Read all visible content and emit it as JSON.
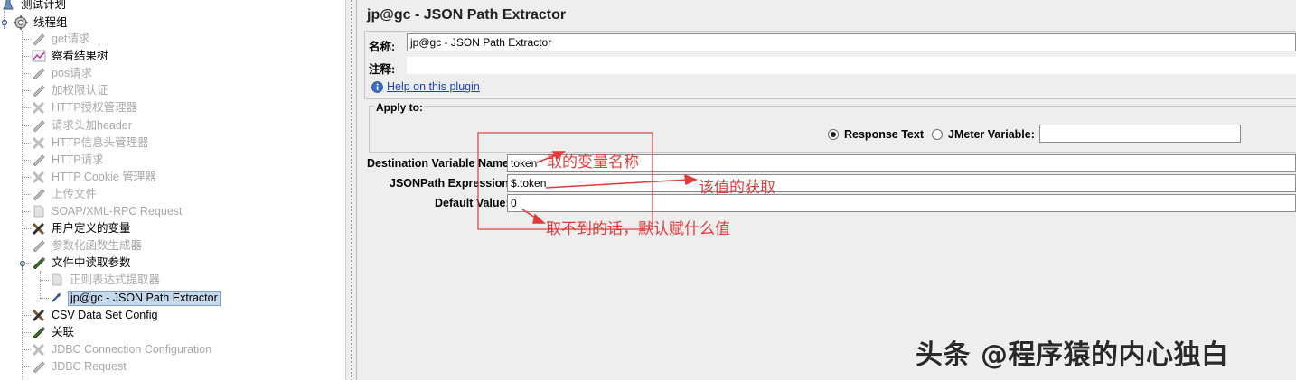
{
  "tree": {
    "root": "测试计划",
    "thread_group": "线程组",
    "items": [
      {
        "label": "get请求",
        "icon": "pencil-icon",
        "disabled": true
      },
      {
        "label": "察看结果树",
        "icon": "chart-icon",
        "disabled": false
      },
      {
        "label": "pos请求",
        "icon": "pencil-icon",
        "disabled": true
      },
      {
        "label": "加权限认证",
        "icon": "pencil-icon",
        "disabled": true
      },
      {
        "label": "HTTP授权管理器",
        "icon": "wrench-icon",
        "disabled": true
      },
      {
        "label": "请求头加header",
        "icon": "pencil-icon",
        "disabled": true
      },
      {
        "label": "HTTP信息头管理器",
        "icon": "wrench-icon",
        "disabled": true
      },
      {
        "label": "HTTP请求",
        "icon": "pencil-icon",
        "disabled": true
      },
      {
        "label": "HTTP Cookie 管理器",
        "icon": "wrench-icon",
        "disabled": true
      },
      {
        "label": "上传文件",
        "icon": "pencil-icon",
        "disabled": true
      },
      {
        "label": "SOAP/XML-RPC Request",
        "icon": "document-icon",
        "disabled": true
      },
      {
        "label": "用户定义的变量",
        "icon": "wrench-icon",
        "disabled": false
      },
      {
        "label": "参数化函数生成器",
        "icon": "pencil-icon",
        "disabled": true
      },
      {
        "label": "文件中读取参数",
        "icon": "pencil-icon",
        "disabled": false
      },
      {
        "label": "正则表达式提取器",
        "icon": "document-icon",
        "disabled": true
      },
      {
        "label": "jp@gc - JSON Path Extractor",
        "icon": "extractor-icon",
        "disabled": false,
        "selected": true
      },
      {
        "label": "CSV Data Set Config",
        "icon": "wrench-icon",
        "disabled": false
      },
      {
        "label": "关联",
        "icon": "pencil-icon",
        "disabled": false
      },
      {
        "label": "JDBC Connection Configuration",
        "icon": "wrench-icon",
        "disabled": true
      },
      {
        "label": "JDBC Request",
        "icon": "pencil-icon",
        "disabled": true
      }
    ]
  },
  "panel": {
    "title": "jp@gc - JSON Path Extractor",
    "name_label": "名称:",
    "name_value": "jp@gc - JSON Path Extractor",
    "comment_label": "注释:",
    "comment_value": "",
    "help_link": "Help on this plugin",
    "apply_to_label": "Apply to:",
    "radio_response_text": "Response Text",
    "radio_jmeter_variable": "JMeter Variable:",
    "jmeter_variable_value": "",
    "dest_var_label": "Destination Variable Name:",
    "dest_var_value": "token",
    "jsonpath_label": "JSONPath Expression:",
    "jsonpath_value": "$.token",
    "default_label": "Default Value:",
    "default_value": "0"
  },
  "annotations": {
    "note_var_name": "取的变量名称",
    "note_value_get": "该值的获取",
    "note_default": "取不到的话，默认赋什么值",
    "color": "#e03a3a"
  },
  "watermark": "头条 @程序猿的内心独白",
  "colors": {
    "panel_bg": "#eeeeee",
    "selection_bg": "#c4d8ee",
    "link": "#1f3fbf",
    "disabled_text": "#a8a8a8"
  }
}
